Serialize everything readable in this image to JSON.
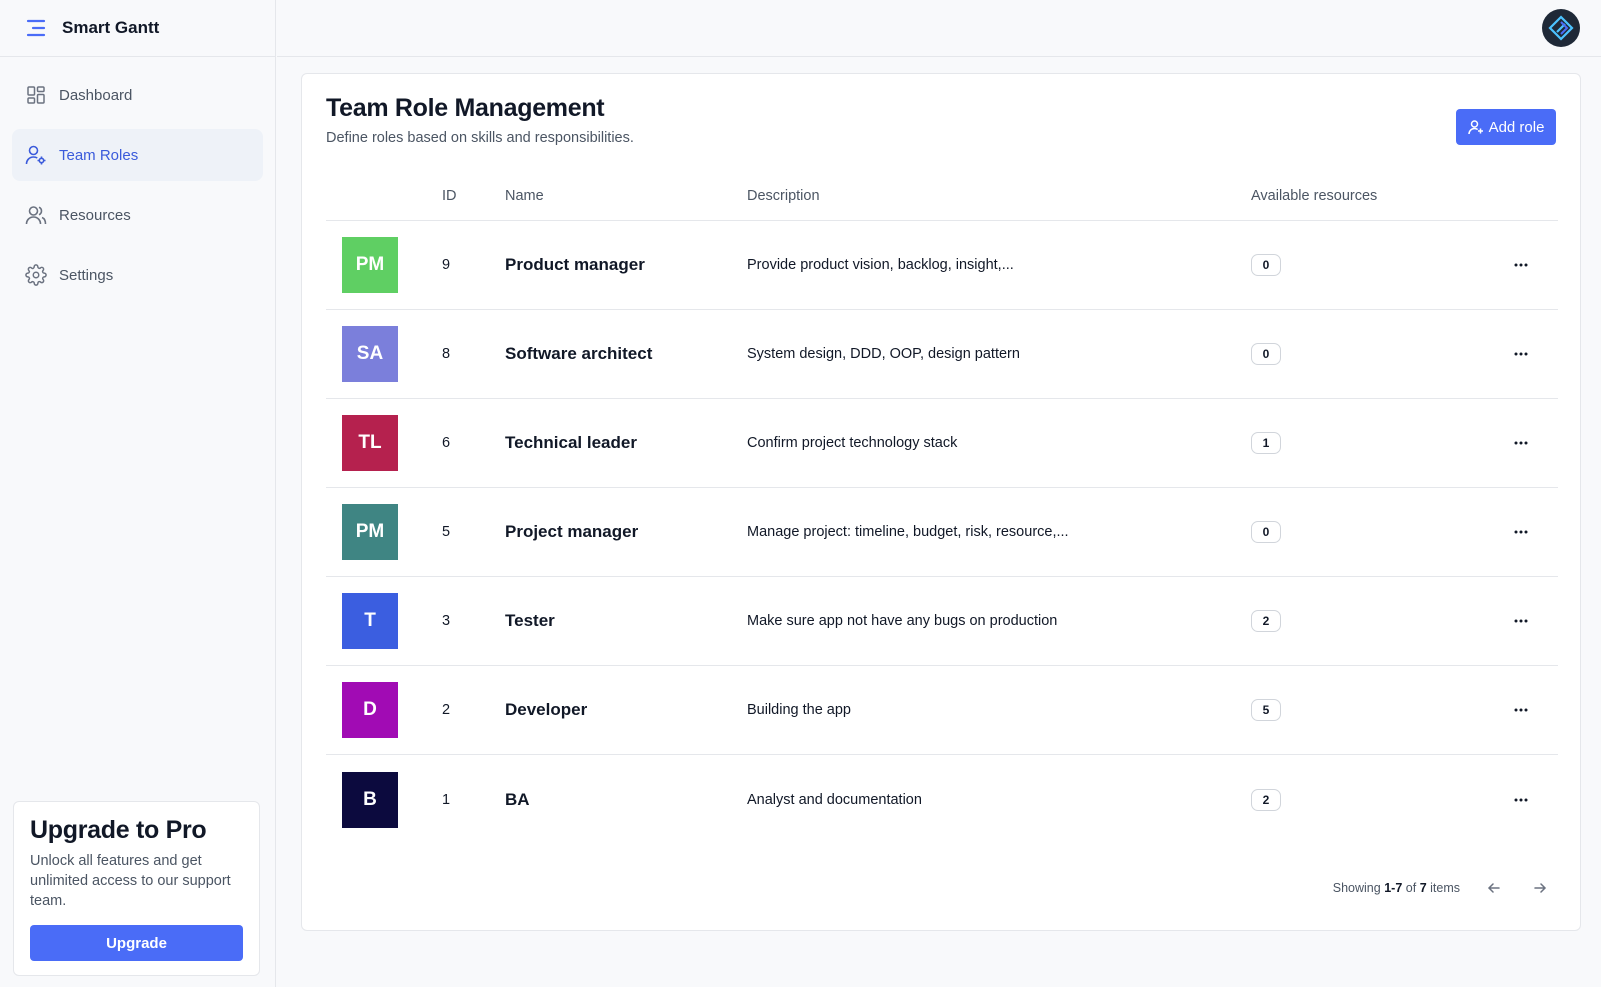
{
  "brand": {
    "title": "Smart Gantt",
    "menu_icon": "menu-icon"
  },
  "sidebar": {
    "items": [
      {
        "label": "Dashboard",
        "icon": "dashboard-icon",
        "active": false
      },
      {
        "label": "Team Roles",
        "icon": "team-roles-icon",
        "active": true
      },
      {
        "label": "Resources",
        "icon": "users-icon",
        "active": false
      },
      {
        "label": "Settings",
        "icon": "gear-icon",
        "active": false
      }
    ],
    "upgrade": {
      "title": "Upgrade to Pro",
      "text": "Unlock all features and get unlimited access to our support team.",
      "button": "Upgrade"
    }
  },
  "header": {
    "logo_icon": "app-logo-icon"
  },
  "page": {
    "title": "Team Role Management",
    "subtitle": "Define roles based on skills and responsibilities.",
    "add_button": "Add role"
  },
  "table": {
    "columns": [
      "",
      "ID",
      "Name",
      "Description",
      "Available resources",
      ""
    ],
    "rows": [
      {
        "initials": "PM",
        "color": "#5fcf63",
        "id": "9",
        "name": "Product manager",
        "description": "Provide product vision, backlog, insight,...",
        "resources": "0"
      },
      {
        "initials": "SA",
        "color": "#7b7fdb",
        "id": "8",
        "name": "Software architect",
        "description": "System design, DDD, OOP, design pattern",
        "resources": "0"
      },
      {
        "initials": "TL",
        "color": "#b5214e",
        "id": "6",
        "name": "Technical leader",
        "description": "Confirm project technology stack",
        "resources": "1"
      },
      {
        "initials": "PM",
        "color": "#3f8583",
        "id": "5",
        "name": "Project manager",
        "description": "Manage project: timeline, budget, risk, resource,...",
        "resources": "0"
      },
      {
        "initials": "T",
        "color": "#3b5ee0",
        "id": "3",
        "name": "Tester",
        "description": "Make sure app not have any bugs on production",
        "resources": "2"
      },
      {
        "initials": "D",
        "color": "#a10bb4",
        "id": "2",
        "name": "Developer",
        "description": "Building the app",
        "resources": "5"
      },
      {
        "initials": "B",
        "color": "#0c0a3e",
        "id": "1",
        "name": "BA",
        "description": "Analyst and documentation",
        "resources": "2"
      }
    ]
  },
  "pagination": {
    "prefix": "Showing",
    "range": "1-7",
    "of": "of",
    "total": "7",
    "suffix": "items"
  },
  "colors": {
    "accent": "#4a6cf7",
    "active_nav": "#3b5bdb"
  }
}
